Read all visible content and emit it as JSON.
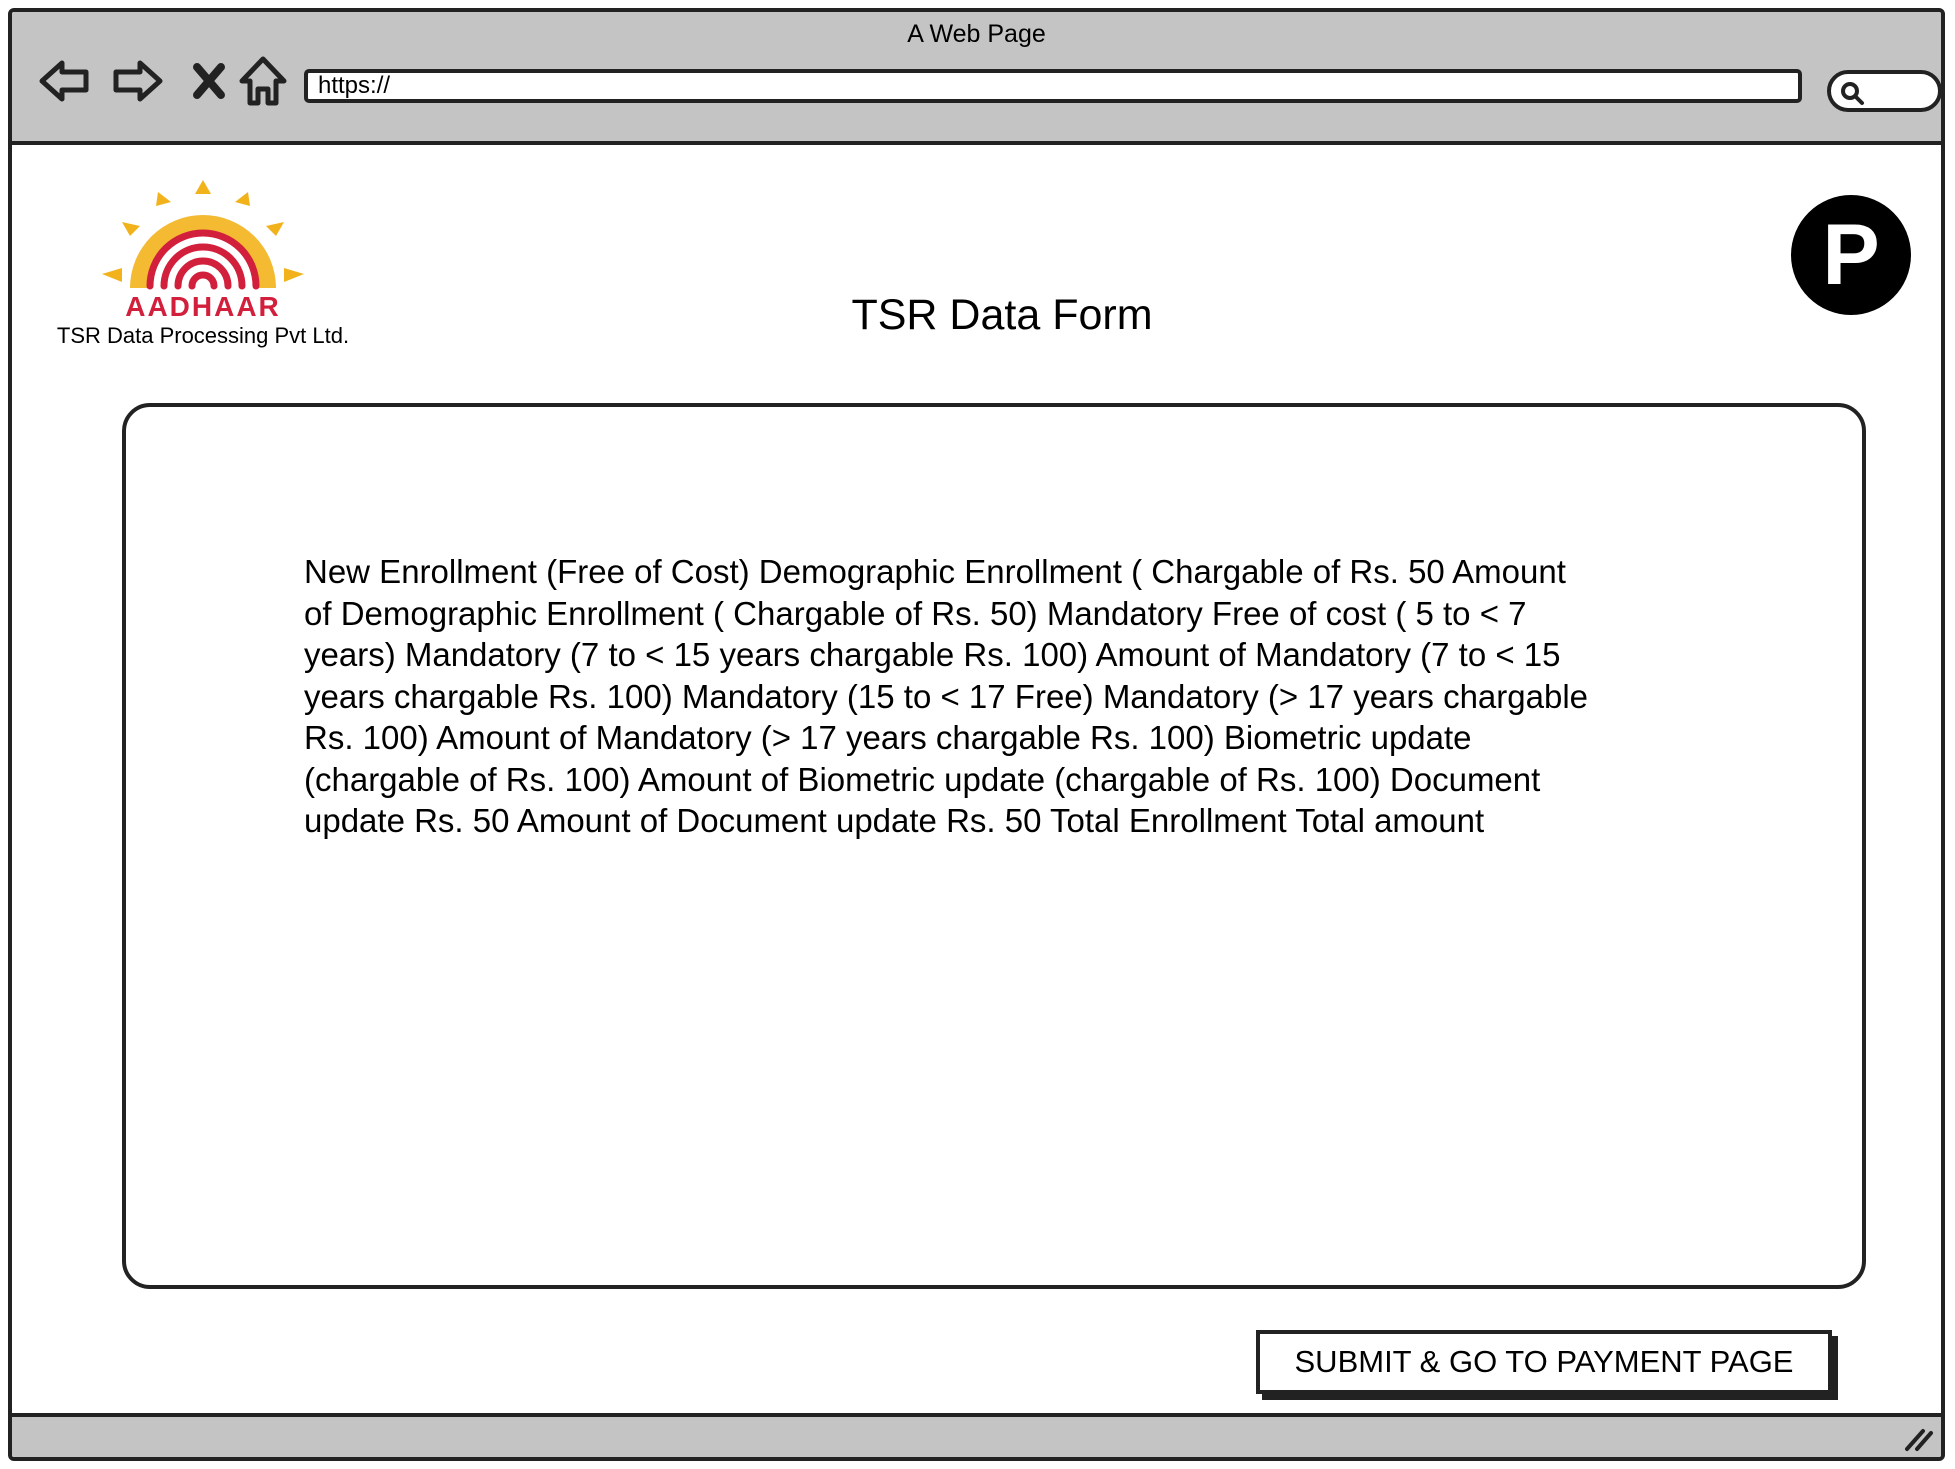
{
  "browser": {
    "window_title": "A Web Page",
    "url": "https://",
    "icons": [
      "back-arrow-icon",
      "forward-arrow-icon",
      "close-x-icon",
      "home-icon",
      "search-icon",
      "resize-grip-icon"
    ]
  },
  "header": {
    "logo_word": "AADHAAR",
    "company_name": "TSR Data Processing Pvt Ltd.",
    "page_title": "TSR Data Form",
    "avatar_letter": "P"
  },
  "form": {
    "content": "New Enrollment (Free of Cost) Demographic Enrollment ( Chargable of Rs. 50 Amount\nof Demographic Enrollment ( Chargable of Rs. 50) Mandatory Free of cost ( 5 to < 7\nyears) Mandatory (7 to < 15 years chargable Rs. 100)  Amount of Mandatory (7 to < 15\nyears chargable Rs. 100) Mandatory (15 to < 17 Free) Mandatory (> 17 years chargable\nRs. 100) Amount of Mandatory (> 17 years chargable Rs. 100) Biometric update\n(chargable of Rs. 100) Amount of Biometric update (chargable of Rs. 100) Document\nupdate Rs. 50 Amount of Document update Rs. 50 Total Enrollment Total amount"
  },
  "actions": {
    "submit_label": "SUBMIT & GO TO PAYMENT PAGE"
  },
  "colors": {
    "logo_red": "#d21f3c",
    "logo_yellow": "#f2b21c",
    "chrome_gray": "#c4c4c4"
  }
}
